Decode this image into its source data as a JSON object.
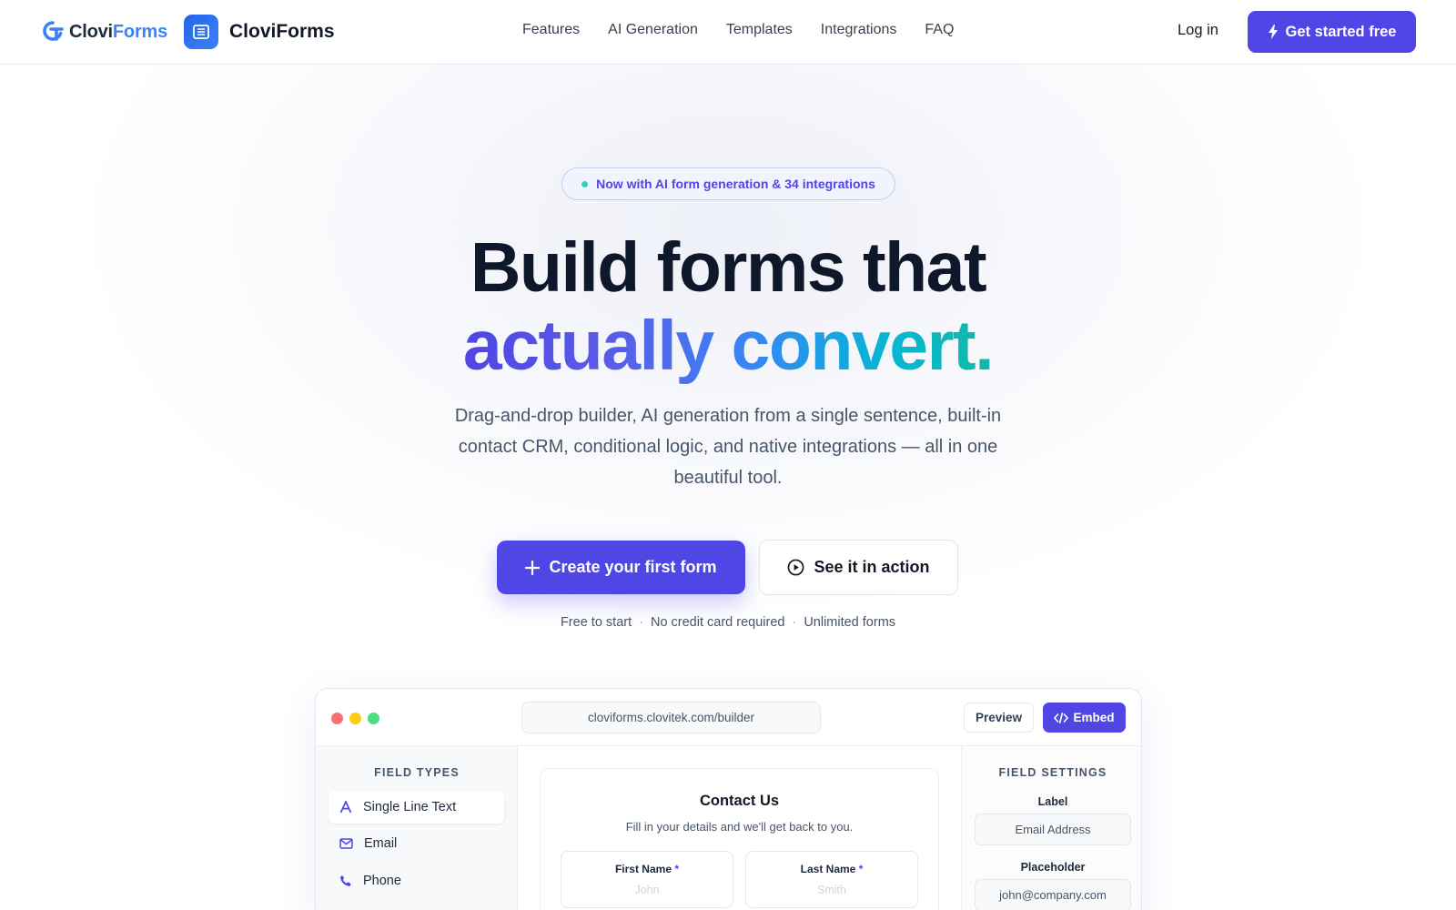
{
  "nav": {
    "logo_word_a": "Clovi",
    "logo_word_b": "Forms",
    "brand_name": "CloviForms",
    "menu": [
      "Features",
      "AI Generation",
      "Templates",
      "Integrations",
      "FAQ"
    ],
    "login": "Log in",
    "cta": "Get started free"
  },
  "hero": {
    "pill": "Now with AI form generation & 34 integrations",
    "title_line1": "Build forms that",
    "title_line2": "actually convert.",
    "subtitle": "Drag-and-drop builder, AI generation from a single sentence, built-in contact CRM, conditional logic, and native integrations — all in one beautiful tool.",
    "primary_button": "Create your first form",
    "secondary_button": "See it in action",
    "perks": [
      "Free to start",
      "No credit card required",
      "Unlimited forms"
    ]
  },
  "builder": {
    "url": "cloviforms.clovitek.com/builder",
    "preview": "Preview",
    "embed": "Embed",
    "field_types_title": "FIELD TYPES",
    "field_types": [
      {
        "label": "Single Line Text",
        "icon": "text-icon"
      },
      {
        "label": "Email",
        "icon": "mail-icon"
      },
      {
        "label": "Phone",
        "icon": "phone-icon"
      }
    ],
    "form": {
      "title": "Contact Us",
      "subtitle": "Fill in your details and we'll get back to you.",
      "fields": [
        {
          "label": "First Name",
          "required": "*",
          "placeholder": "John"
        },
        {
          "label": "Last Name",
          "required": "*",
          "placeholder": "Smith"
        }
      ]
    },
    "settings_title": "FIELD SETTINGS",
    "settings": {
      "label_title": "Label",
      "label_value": "Email Address",
      "placeholder_title": "Placeholder",
      "placeholder_value": "john@company.com"
    }
  },
  "colors": {
    "accent": "#4f46e5",
    "brand_blue": "#3b82f6",
    "teal": "#14b8a6",
    "traffic_red": "#f87171",
    "traffic_yellow": "#facc15",
    "traffic_green": "#4ade80"
  }
}
